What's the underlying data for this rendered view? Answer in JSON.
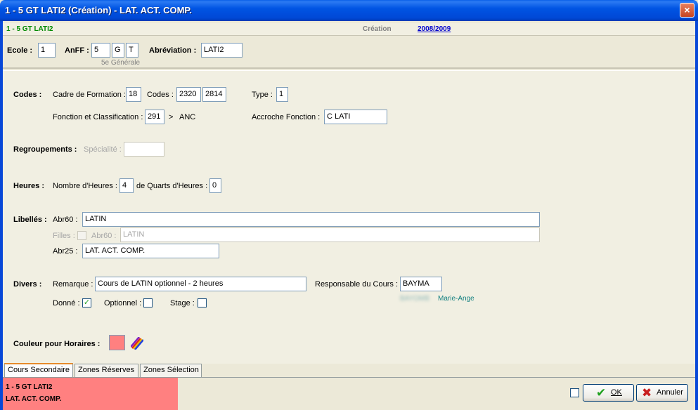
{
  "window": {
    "title": "1 - 5 GT  LATI2 (Création) - LAT. ACT. COMP.",
    "close_label": "×"
  },
  "header": {
    "code": "1 - 5 GT  LATI2",
    "mode": "Création",
    "year": "2008/2009"
  },
  "top": {
    "ecole_label": "Ecole :",
    "ecole_value": "1",
    "anff_label": "AnFF :",
    "anff_values": [
      "5",
      "G",
      "T"
    ],
    "anff_desc": "5e Générale",
    "abbr_label": "Abréviation :",
    "abbr_value": "LATI2"
  },
  "codes": {
    "section_label": "Codes :",
    "cadre_label": "Cadre de Formation :",
    "cadre_value": "18",
    "codes_label": "Codes :",
    "codes_values": [
      "2320",
      "2814"
    ],
    "type_label": "Type :",
    "type_value": "1",
    "fonction_label": "Fonction et Classification :",
    "fonction_value": "291",
    "fonction_arrow": ">",
    "fonction_class": "ANC",
    "accroche_label": "Accroche Fonction :",
    "accroche_value": "C LATI"
  },
  "regroupements": {
    "section_label": "Regroupements :",
    "specialite_label": "Spécialité :",
    "specialite_value": ""
  },
  "heures": {
    "section_label": "Heures :",
    "nombre_label": "Nombre d'Heures :",
    "nombre_value": "4",
    "quarts_label": "de Quarts d'Heures :",
    "quarts_value": "0"
  },
  "libelles": {
    "section_label": "Libellés :",
    "abr60_label": "Abr60 :",
    "abr60_value": "LATIN",
    "filles_label": "Filles :",
    "filles_abr60_label": "Abr60 :",
    "filles_abr60_value": "LATIN",
    "abr25_label": "Abr25 :",
    "abr25_value": "LAT. ACT. COMP."
  },
  "divers": {
    "section_label": "Divers :",
    "remarque_label": "Remarque :",
    "remarque_value": "Cours de LATIN optionnel - 2 heures",
    "responsable_label": "Responsable du Cours :",
    "responsable_value": "BAYMA",
    "responsable_name_blurred": "BAYOMB",
    "responsable_firstname": "Marie-Ange",
    "donne_label": "Donné :",
    "donne_checked": "✓",
    "optionnel_label": "Optionnel :",
    "stage_label": "Stage :"
  },
  "couleur": {
    "label": "Couleur pour Horaires :",
    "color": "#FF8080"
  },
  "tabs": [
    {
      "label": "Cours Secondaire"
    },
    {
      "label": "Zones Réserves"
    },
    {
      "label": "Zones Sélection"
    }
  ],
  "summary": {
    "line1": "1 - 5 GT  LATI2",
    "line2": "LAT. ACT. COMP."
  },
  "buttons": {
    "ok_label": "OK",
    "cancel_label": "Annuler"
  },
  "icons": {
    "close": "close-icon",
    "checkmark": "check-icon",
    "cancel": "cross-icon",
    "palette": "color-palette-icon"
  }
}
